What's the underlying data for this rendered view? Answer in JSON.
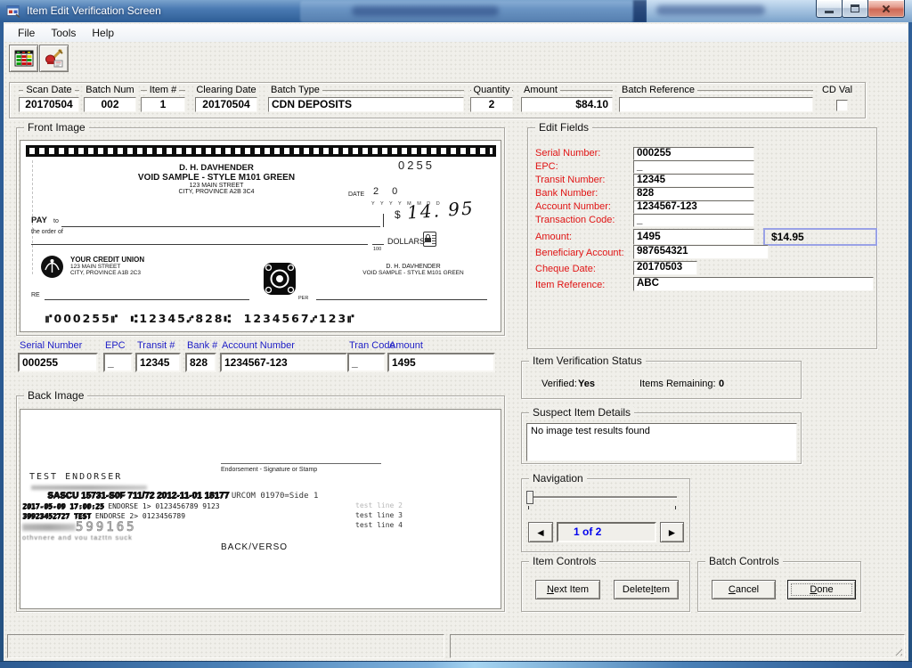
{
  "window": {
    "title": "Item Edit Verification Screen"
  },
  "menu": {
    "items": [
      {
        "label": "File"
      },
      {
        "label": "Tools"
      },
      {
        "label": "Help"
      }
    ]
  },
  "header": {
    "scan_date_label": "Scan Date",
    "scan_date": "20170504",
    "batch_num_label": "Batch Num",
    "batch_num": "002",
    "item_num_label": "Item #",
    "item_num": "1",
    "clearing_date_label": "Clearing Date",
    "clearing_date": "20170504",
    "batch_type_label": "Batch Type",
    "batch_type": "CDN DEPOSITS",
    "quantity_label": "Quantity",
    "quantity": "2",
    "amount_label": "Amount",
    "amount": "$84.10",
    "batch_reference_label": "Batch Reference",
    "batch_reference": "",
    "cd_val_label": "CD Val"
  },
  "front_image": {
    "title": "Front Image",
    "cheque_number": "0255",
    "payer_name": "D. H. DAVHENDER",
    "payer_style": "VOID SAMPLE - STYLE M101 GREEN",
    "payer_street": "123 MAIN STREET",
    "payer_city": "CITY, PROVINCE  A2B 3C4",
    "date_label": "DATE",
    "date_value": "2 0",
    "date_format": "Y Y Y Y M M D D",
    "currency_symbol": "$",
    "amount_written": "14. 95",
    "pay_label": "PAY",
    "to_label": "to",
    "order_label": "the order of",
    "dollars_label": "DOLLARS",
    "dollars_fraction": "100",
    "bank_name": "YOUR CREDIT UNION",
    "bank_street": "123 MAIN STREET",
    "bank_city": "CITY, PROVINCE  A1B 2C3",
    "drawer_name": "D. H. DAVHENDER",
    "drawer_style": "VOID SAMPLE - STYLE M101 GREEN",
    "re_label": "RE",
    "per_label": "PER",
    "micr_line": "⑈000255⑈  ⑆12345⑇828⑆  1234567⑇123⑈"
  },
  "micr_fields": {
    "serial_label": "Serial Number",
    "serial": "000255",
    "epc_label": "EPC",
    "epc": "_",
    "transit_label": "Transit #",
    "transit": "12345",
    "bank_label": "Bank #",
    "bank": "828",
    "account_label": "Account Number",
    "account": "1234567-123",
    "tran_code_label": "Tran Code",
    "tran_code": "_",
    "amount_label": "Amount",
    "amount": "1495"
  },
  "back_image": {
    "title": "Back Image",
    "endorser": "TEST ENDORSER",
    "endorsement_caption": "Endorsement - Signature or Stamp",
    "stamp_heavy": "SASCU 15731-S0F 711/72 2012-11-01 18177",
    "stamp_urcom": "URCOM 01970=Side 1",
    "stamp_timestamp": "2017-05-09 17:00:25",
    "endorse1": "ENDORSE 1> 0123456789 9123",
    "stamp_garble3": "39923452727 TEST",
    "endorse2": "ENDORSE 2> 0123456789",
    "stamp_number": "599165",
    "stamp_faint": "othvnere and vou tazttn suck",
    "test_line2": "test line 2",
    "test_line3": "test line 3",
    "test_line4": "test line 4",
    "back_verso": "BACK/VERSO"
  },
  "edit_fields": {
    "title": "Edit Fields",
    "serial_label": "Serial Number:",
    "serial": "000255",
    "epc_label": "EPC:",
    "epc": "_",
    "transit_label": "Transit Number:",
    "transit": "12345",
    "bank_label": "Bank Number:",
    "bank": "828",
    "account_label": "Account Number:",
    "account": "1234567-123",
    "tran_code_label": "Transaction Code:",
    "tran_code": "_",
    "amount_label": "Amount:",
    "amount": "1495",
    "amount_formatted": "$14.95",
    "beneficiary_label": "Beneficiary Account:",
    "beneficiary": "987654321",
    "cheque_date_label": "Cheque Date:",
    "cheque_date": "20170503",
    "item_reference_label": "Item Reference:",
    "item_reference": "ABC"
  },
  "verification": {
    "title": "Item Verification Status",
    "verified_label": "Verified:",
    "verified": "Yes",
    "remaining_label": "Items Remaining:",
    "remaining": "0"
  },
  "suspect": {
    "title": "Suspect Item Details",
    "text": "No image test results found"
  },
  "navigation": {
    "title": "Navigation",
    "position": "1 of 2",
    "prev_glyph": "◄",
    "next_glyph": "►"
  },
  "item_controls": {
    "title": "Item Controls",
    "next": {
      "label": "Next Item",
      "key": "N"
    },
    "delete": {
      "label": "Delete Item",
      "key": "I"
    }
  },
  "batch_controls": {
    "title": "Batch Controls",
    "cancel": {
      "label": "Cancel",
      "key": "C"
    },
    "done": {
      "label": "Done",
      "key": "D"
    }
  },
  "colors": {
    "label_red": "#e01414",
    "label_blue": "#1d1dc6",
    "nav_text_blue": "#0000ee",
    "amount_box_border": "#9aa2e6",
    "titlebar_blue": "#2f5f98"
  }
}
